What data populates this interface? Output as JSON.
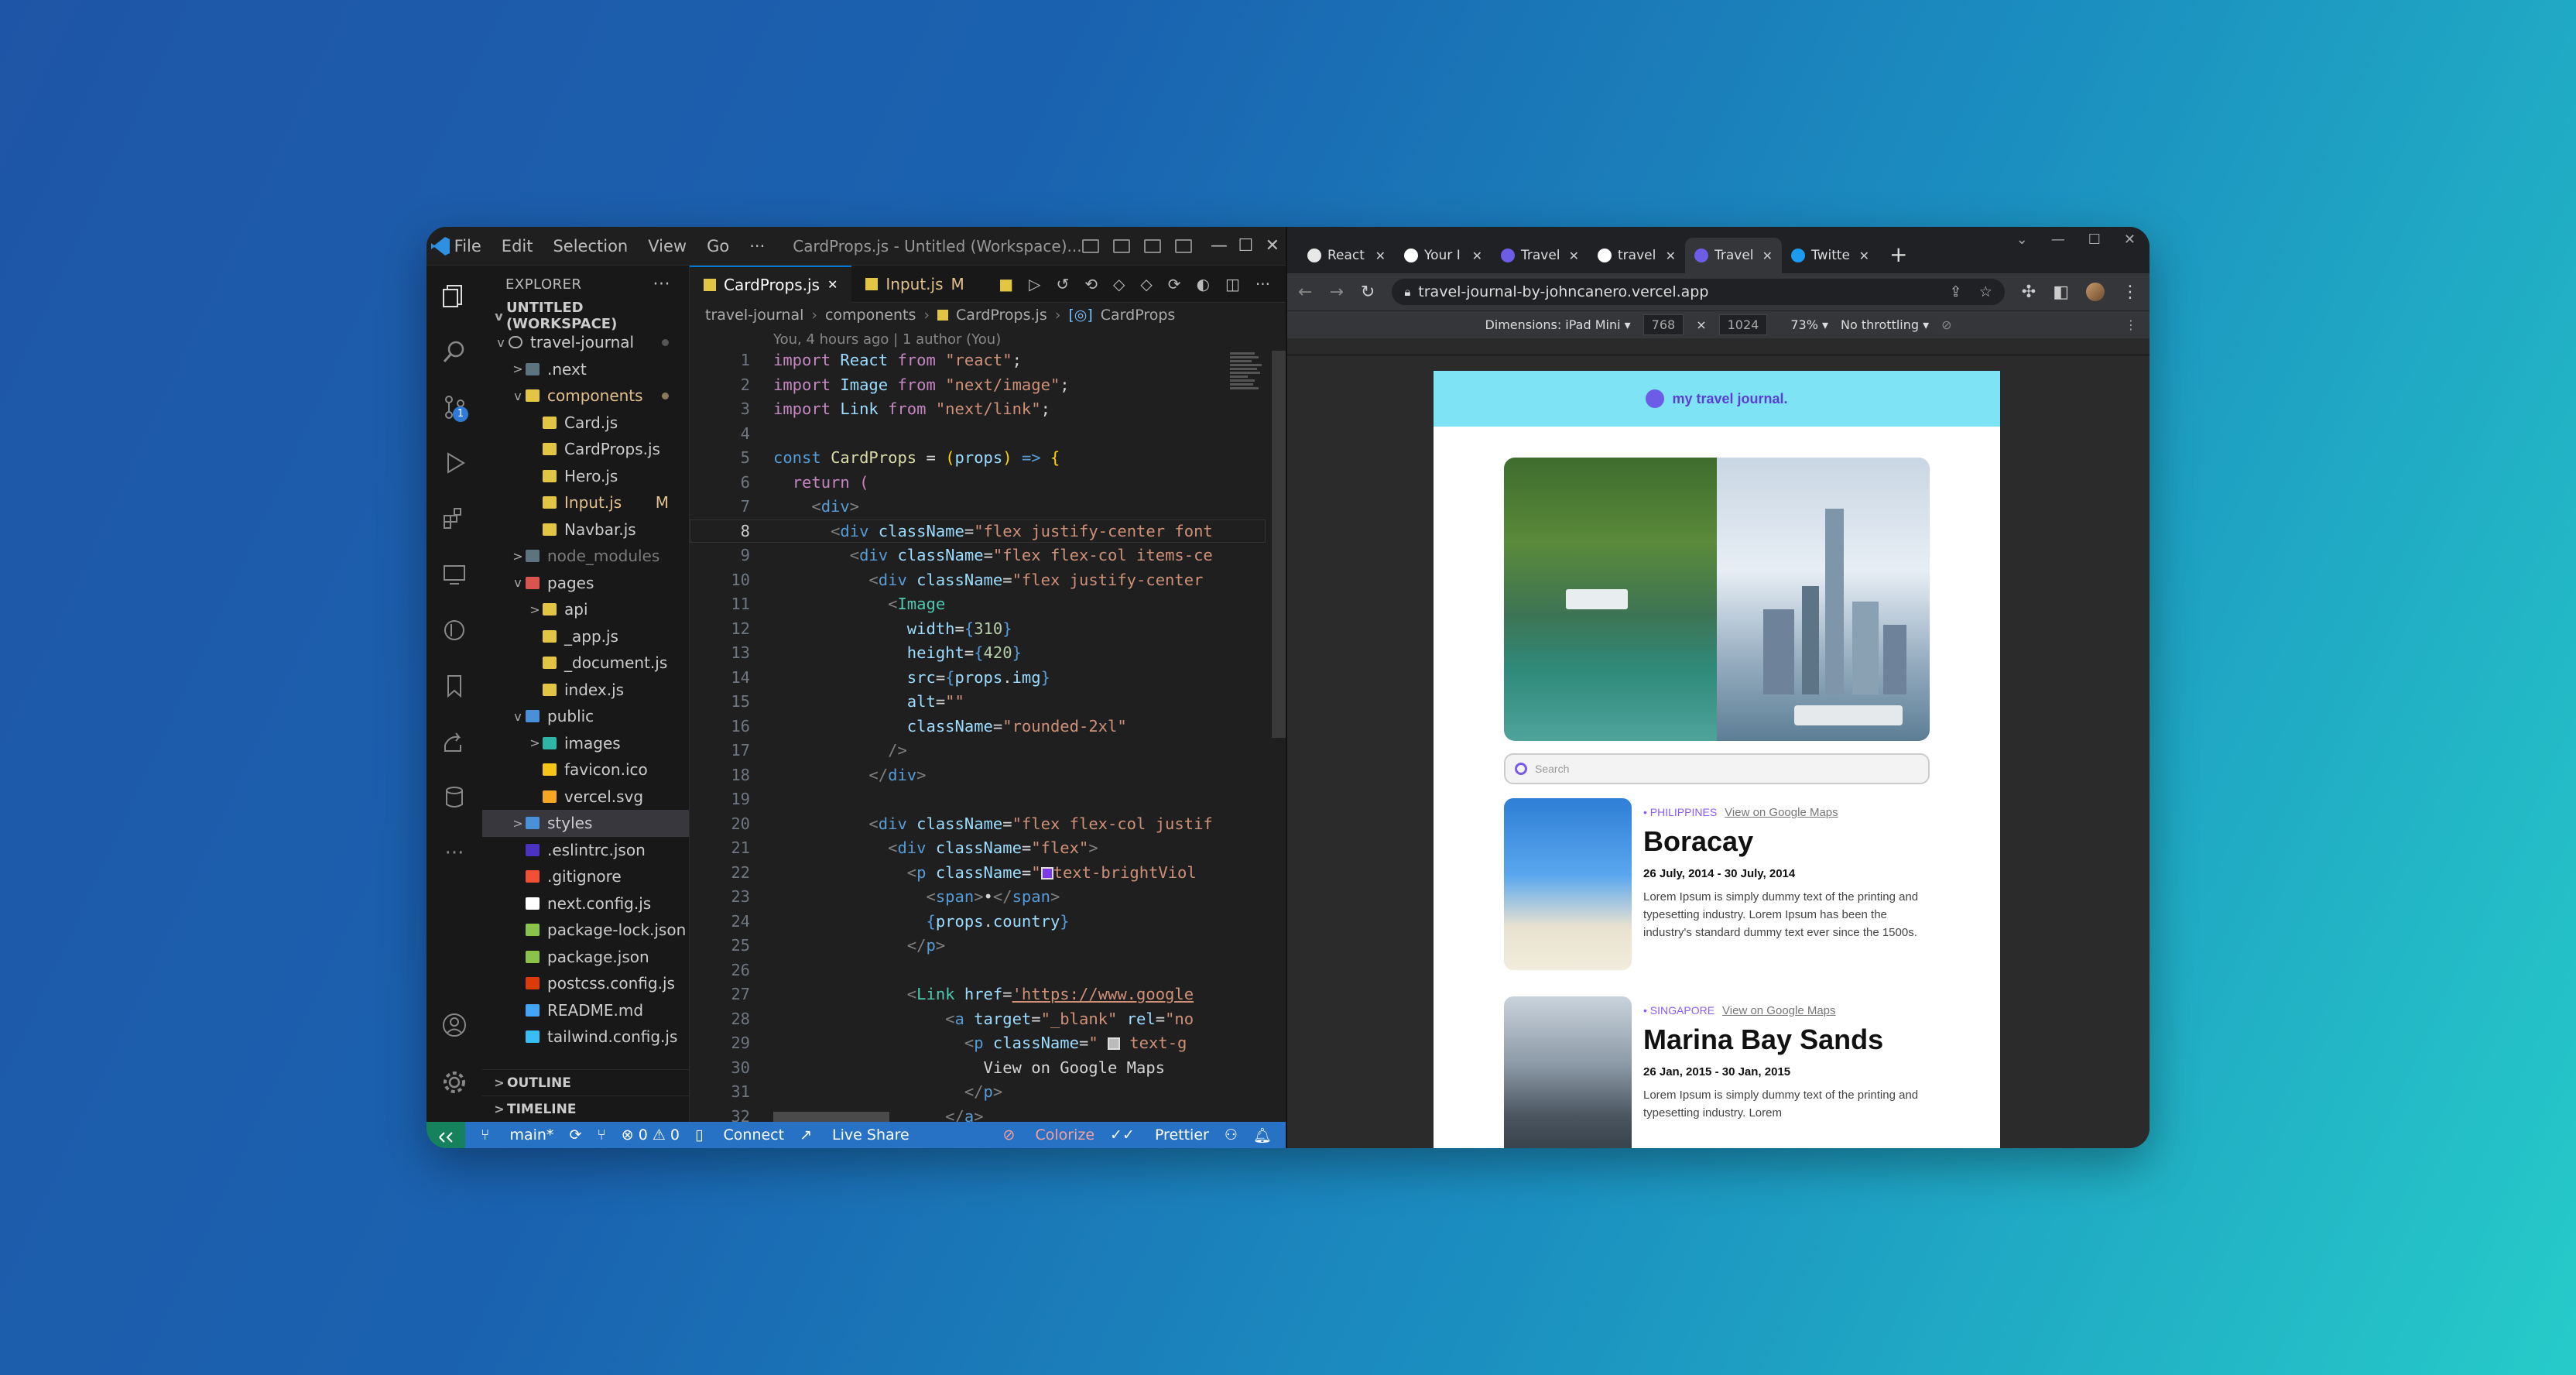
{
  "vscode": {
    "menu": [
      "File",
      "Edit",
      "Selection",
      "View",
      "Go",
      "···"
    ],
    "window_title": "CardProps.js - Untitled (Workspace)...",
    "explorer_title": "EXPLORER",
    "explorer_more": "···",
    "workspace": "UNTITLED (WORKSPACE)",
    "source_control_badge": "1",
    "tree": [
      {
        "label": "travel-journal",
        "depth": 0,
        "twisty": "v",
        "kind": "root",
        "dot": true
      },
      {
        "label": ".next",
        "depth": 1,
        "twisty": ">",
        "kind": "folder-dim"
      },
      {
        "label": "components",
        "depth": 1,
        "twisty": "v",
        "kind": "folder-open",
        "dot": true,
        "color": "#e2c08d"
      },
      {
        "label": "Card.js",
        "depth": 2,
        "kind": "js"
      },
      {
        "label": "CardProps.js",
        "depth": 2,
        "kind": "js"
      },
      {
        "label": "Hero.js",
        "depth": 2,
        "kind": "js"
      },
      {
        "label": "Input.js",
        "depth": 2,
        "kind": "js",
        "mod": "M",
        "color": "#e2c08d"
      },
      {
        "label": "Navbar.js",
        "depth": 2,
        "kind": "js"
      },
      {
        "label": "node_modules",
        "depth": 1,
        "twisty": ">",
        "kind": "folder-dim",
        "color": "#7a7a7a"
      },
      {
        "label": "pages",
        "depth": 1,
        "twisty": "v",
        "kind": "folder-red"
      },
      {
        "label": "api",
        "depth": 2,
        "twisty": ">",
        "kind": "folder"
      },
      {
        "label": "_app.js",
        "depth": 2,
        "kind": "js"
      },
      {
        "label": "_document.js",
        "depth": 2,
        "kind": "js"
      },
      {
        "label": "index.js",
        "depth": 2,
        "kind": "js"
      },
      {
        "label": "public",
        "depth": 1,
        "twisty": "v",
        "kind": "folder-blue"
      },
      {
        "label": "images",
        "depth": 2,
        "twisty": ">",
        "kind": "folder-teal"
      },
      {
        "label": "favicon.ico",
        "depth": 2,
        "kind": "star"
      },
      {
        "label": "vercel.svg",
        "depth": 2,
        "kind": "svg"
      },
      {
        "label": "styles",
        "depth": 1,
        "twisty": ">",
        "kind": "folder-blue",
        "selected": true
      },
      {
        "label": ".eslintrc.json",
        "depth": 1,
        "kind": "eslint"
      },
      {
        "label": ".gitignore",
        "depth": 1,
        "kind": "git"
      },
      {
        "label": "next.config.js",
        "depth": 1,
        "kind": "next"
      },
      {
        "label": "package-lock.json",
        "depth": 1,
        "kind": "npm"
      },
      {
        "label": "package.json",
        "depth": 1,
        "kind": "npm"
      },
      {
        "label": "postcss.config.js",
        "depth": 1,
        "kind": "postcss"
      },
      {
        "label": "README.md",
        "depth": 1,
        "kind": "info"
      },
      {
        "label": "tailwind.config.js",
        "depth": 1,
        "kind": "tailwind"
      }
    ],
    "outline": "OUTLINE",
    "timeline": "TIMELINE",
    "tabs": [
      {
        "label": "CardProps.js",
        "active": true,
        "close": "✕"
      },
      {
        "label": "Input.js",
        "mod": "M"
      }
    ],
    "breadcrumb": [
      "travel-journal",
      "components",
      "CardProps.js",
      "CardProps"
    ],
    "blame": "You, 4 hours ago | 1 author (You)",
    "status": {
      "branch": "main*",
      "problems": "⊗ 0 ⚠ 0",
      "connect": "Connect",
      "liveshare": "Live Share",
      "colorize": "Colorize",
      "prettier": "Prettier"
    }
  },
  "browser": {
    "tabs": [
      {
        "label": "React",
        "fav": "#e8e8e8"
      },
      {
        "label": "Your I",
        "fav": "#ffffff"
      },
      {
        "label": "Travel",
        "fav": "#6d5ce6"
      },
      {
        "label": "travel",
        "fav": "#ffffff"
      },
      {
        "label": "Travel",
        "fav": "#6d5ce6",
        "current": true
      },
      {
        "label": "Twitte",
        "fav": "#1d9bf0"
      }
    ],
    "url": "travel-journal-by-johncanero.vercel.app",
    "device": {
      "dimensions": "Dimensions: iPad Mini ▾",
      "width": "768",
      "x": "×",
      "height": "1024",
      "zoom": "73% ▾",
      "throttle": "No throttling ▾"
    },
    "site": {
      "brand": "my travel journal.",
      "search_placeholder": "Search",
      "entries": [
        {
          "country": "• PHILIPPINES",
          "maps": "View on Google Maps",
          "place": "Boracay",
          "dates": "26 July, 2014 - 30 July, 2014",
          "desc": "Lorem Ipsum is simply dummy text of the printing and typesetting industry. Lorem Ipsum has been the industry's standard dummy text ever since the 1500s."
        },
        {
          "country": "• SINGAPORE",
          "maps": "View on Google Maps",
          "place": "Marina Bay Sands",
          "dates": "26 Jan, 2015 - 30 Jan, 2015",
          "desc": "Lorem Ipsum is simply dummy text of the printing and typesetting industry. Lorem"
        }
      ]
    }
  },
  "colors": {
    "accent": "#0078d4",
    "status_bar": "#2772c4",
    "site_nav": "#7fe3f6",
    "brand": "#5a3fd1"
  }
}
